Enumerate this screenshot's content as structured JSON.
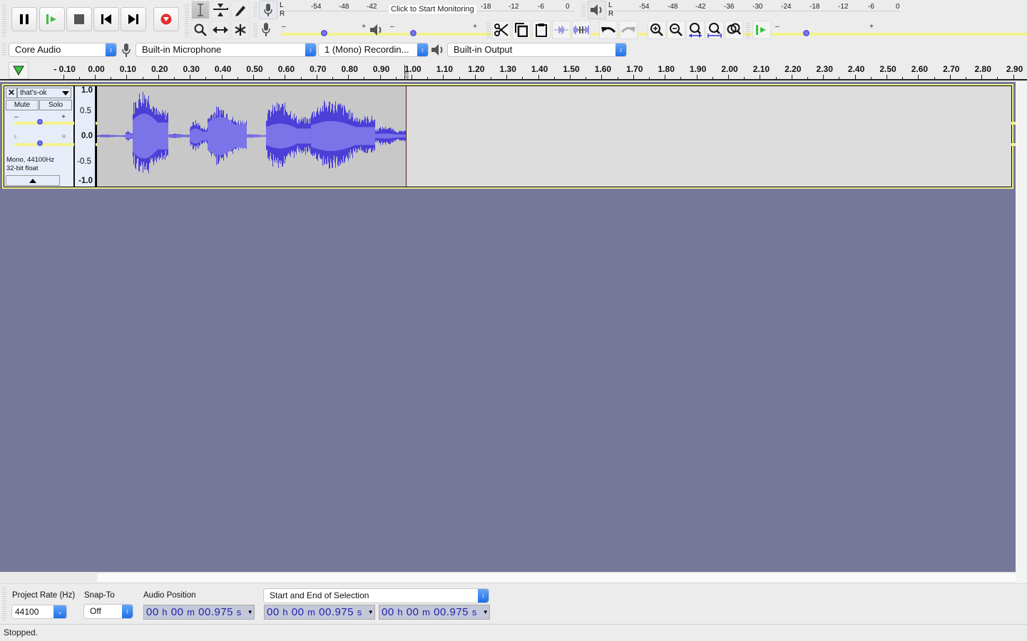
{
  "transport": {
    "buttons": [
      {
        "name": "pause",
        "label": "Pause"
      },
      {
        "name": "play",
        "label": "Play"
      },
      {
        "name": "stop",
        "label": "Stop"
      },
      {
        "name": "skip-start",
        "label": "Skip to Start"
      },
      {
        "name": "skip-end",
        "label": "Skip to End"
      },
      {
        "name": "record",
        "label": "Record"
      }
    ]
  },
  "tools": [
    "Selection Tool",
    "Envelope Tool",
    "Draw Tool",
    "Zoom Tool",
    "Time Shift Tool",
    "Multi-Tool"
  ],
  "recording_meter": {
    "channels": [
      "L",
      "R"
    ],
    "ticks": [
      "-54",
      "-48",
      "-42",
      "-18",
      "-12",
      "-6",
      "0"
    ],
    "prompt": "Click to Start Monitoring"
  },
  "playback_meter": {
    "channels": [
      "L",
      "R"
    ],
    "ticks": [
      "-54",
      "-48",
      "-42",
      "-36",
      "-30",
      "-24",
      "-18",
      "-12",
      "-6",
      "0"
    ]
  },
  "mixer": {
    "minus": "–",
    "plus": "+",
    "recording_volume": 0.5,
    "playback_volume": 0.25
  },
  "play_at_speed": {
    "minus": "–",
    "plus": "+",
    "speed": 0.3
  },
  "devices": {
    "host": "Core Audio",
    "input": "Built-in Microphone",
    "channels": "1 (Mono) Recordin...",
    "output": "Built-in Output"
  },
  "ruler": {
    "labels": [
      "- 0.10",
      "0.00",
      "0.10",
      "0.20",
      "0.30",
      "0.40",
      "0.50",
      "0.60",
      "0.70",
      "0.80",
      "0.90",
      "1.00",
      "1.10",
      "1.20",
      "1.30",
      "1.40",
      "1.50",
      "1.60",
      "1.70",
      "1.80",
      "1.90",
      "2.00",
      "2.10",
      "2.20",
      "2.30",
      "2.40",
      "2.50",
      "2.60",
      "2.70",
      "2.80",
      "2.90"
    ],
    "cursor_position_s": 0.975
  },
  "track": {
    "name": "that's-ok",
    "mute": "Mute",
    "solo": "Solo",
    "gain_minus": "–",
    "gain_plus": "+",
    "pan_left": "L",
    "pan_right": "R",
    "gain": 0.5,
    "pan": 0.5,
    "info_line1": "Mono, 44100Hz",
    "info_line2": "32-bit float",
    "vruler": [
      "1.0",
      "0.5",
      "0.0",
      "-0.5",
      "-1.0"
    ],
    "audio_duration_s": 0.975
  },
  "bottom": {
    "project_rate_label": "Project Rate (Hz)",
    "project_rate": "44100",
    "snap_to_label": "Snap-To",
    "snap_to": "Off",
    "audio_position_label": "Audio Position",
    "audio_position": {
      "h": "00",
      "m": "00",
      "s": "00.975"
    },
    "selection_mode": "Start and End of Selection",
    "selection_start": {
      "h": "00",
      "m": "00",
      "s": "00.975"
    },
    "selection_end": {
      "h": "00",
      "m": "00",
      "s": "00.975"
    },
    "unit_h": "h",
    "unit_m": "m",
    "unit_s": "s"
  },
  "status": "Stopped.",
  "colors": {
    "waveform": "#4b3fd8",
    "waveform_rms": "#7b74e8",
    "selection_bg": "#c8c8c8",
    "track_bg": "#dcdcdc",
    "workspace": "#767899",
    "track_border": "#f2f28a",
    "record": "#e03030",
    "play": "#3cc040"
  }
}
